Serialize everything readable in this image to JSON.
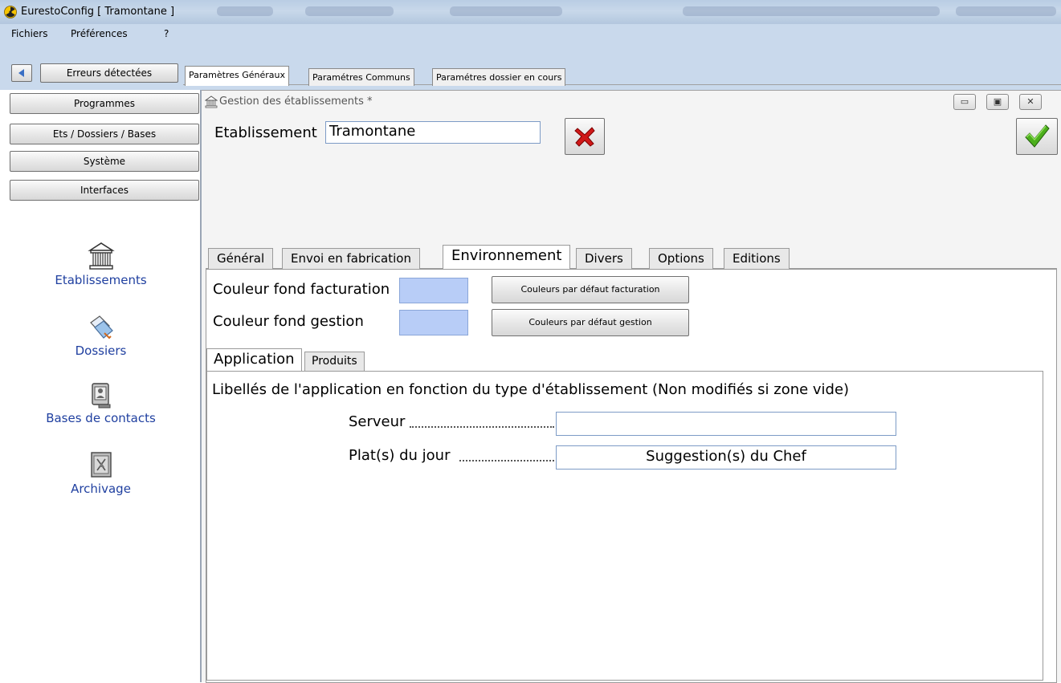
{
  "window": {
    "title": "EurestoConfig [ Tramontane ]",
    "app_icon": "radiation-icon"
  },
  "menu": {
    "items": [
      "Fichiers",
      "Préférences",
      "?"
    ]
  },
  "toolbar": {
    "back_icon": "arrow-left-icon",
    "errors_label": "Erreurs détectées"
  },
  "top_tabs": [
    "Paramètres Généraux",
    "Paramétres Communs",
    "Paramétres dossier en cours"
  ],
  "sidebar": {
    "buttons": [
      "Programmes",
      "Ets / Dossiers / Bases",
      "Système",
      "Interfaces"
    ],
    "nav": [
      {
        "label": "Etablissements",
        "icon": "building-icon"
      },
      {
        "label": "Dossiers",
        "icon": "folders-icon"
      },
      {
        "label": "Bases de contacts",
        "icon": "contacts-base-icon"
      },
      {
        "label": "Archivage",
        "icon": "archive-icon"
      }
    ]
  },
  "form": {
    "window_title": "Gestion des établissements *",
    "window_icon": "building-icon",
    "etablissement_label": "Etablissement",
    "etablissement_value": "Tramontane",
    "cancel_icon": "red-x-icon",
    "validate_icon": "green-check-icon",
    "tabs": [
      "Général",
      "Envoi en fabrication",
      "Environnement",
      "Divers",
      "Options",
      "Editions"
    ],
    "active_tab": "Environnement",
    "couleur_facturation_label": "Couleur fond facturation",
    "couleur_gestion_label": "Couleur fond gestion",
    "swatch_color": "#b8cdf7",
    "default_facturation_button": "Couleurs par défaut facturation",
    "default_gestion_button": "Couleurs par défaut gestion",
    "sub_tabs": [
      "Application",
      "Produits"
    ],
    "active_sub_tab": "Application",
    "section_heading": "Libellés de l'application en fonction du type d'établissement (Non modifiés si zone vide)",
    "serveur_label": "Serveur",
    "serveur_value": "",
    "plat_label": "Plat(s) du jour",
    "plat_value": "Suggestion(s) du Chef"
  }
}
